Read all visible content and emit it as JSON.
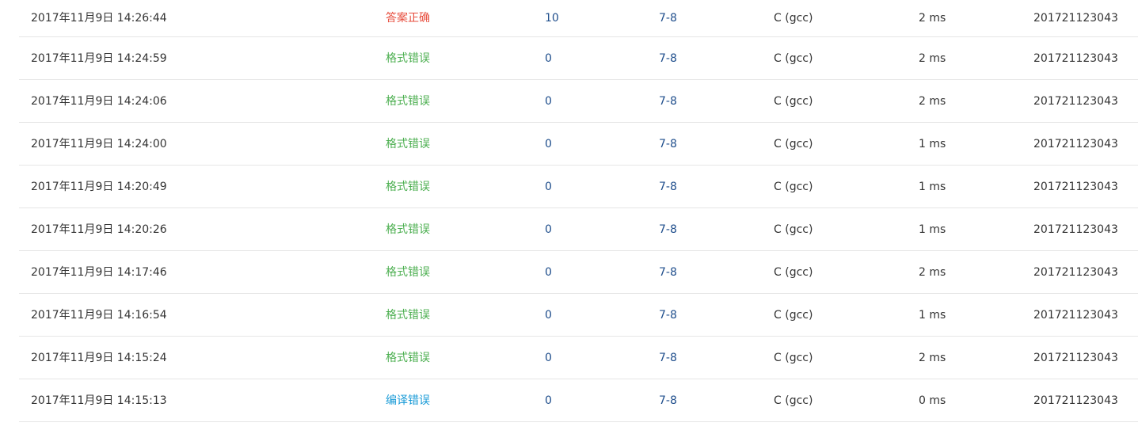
{
  "submissions": [
    {
      "time": "2017年11月9日 14:26:44",
      "status": "答案正确",
      "status_type": "ac",
      "score": "10",
      "problem": "7-8",
      "compiler": "C (gcc)",
      "runtime": "2 ms",
      "user": "201721123043"
    },
    {
      "time": "2017年11月9日 14:24:59",
      "status": "格式错误",
      "status_type": "pe",
      "score": "0",
      "problem": "7-8",
      "compiler": "C (gcc)",
      "runtime": "2 ms",
      "user": "201721123043"
    },
    {
      "time": "2017年11月9日 14:24:06",
      "status": "格式错误",
      "status_type": "pe",
      "score": "0",
      "problem": "7-8",
      "compiler": "C (gcc)",
      "runtime": "2 ms",
      "user": "201721123043"
    },
    {
      "time": "2017年11月9日 14:24:00",
      "status": "格式错误",
      "status_type": "pe",
      "score": "0",
      "problem": "7-8",
      "compiler": "C (gcc)",
      "runtime": "1 ms",
      "user": "201721123043"
    },
    {
      "time": "2017年11月9日 14:20:49",
      "status": "格式错误",
      "status_type": "pe",
      "score": "0",
      "problem": "7-8",
      "compiler": "C (gcc)",
      "runtime": "1 ms",
      "user": "201721123043"
    },
    {
      "time": "2017年11月9日 14:20:26",
      "status": "格式错误",
      "status_type": "pe",
      "score": "0",
      "problem": "7-8",
      "compiler": "C (gcc)",
      "runtime": "1 ms",
      "user": "201721123043"
    },
    {
      "time": "2017年11月9日 14:17:46",
      "status": "格式错误",
      "status_type": "pe",
      "score": "0",
      "problem": "7-8",
      "compiler": "C (gcc)",
      "runtime": "2 ms",
      "user": "201721123043"
    },
    {
      "time": "2017年11月9日 14:16:54",
      "status": "格式错误",
      "status_type": "pe",
      "score": "0",
      "problem": "7-8",
      "compiler": "C (gcc)",
      "runtime": "1 ms",
      "user": "201721123043"
    },
    {
      "time": "2017年11月9日 14:15:24",
      "status": "格式错误",
      "status_type": "pe",
      "score": "0",
      "problem": "7-8",
      "compiler": "C (gcc)",
      "runtime": "2 ms",
      "user": "201721123043"
    },
    {
      "time": "2017年11月9日 14:15:13",
      "status": "编译错误",
      "status_type": "ce",
      "score": "0",
      "problem": "7-8",
      "compiler": "C (gcc)",
      "runtime": "0 ms",
      "user": "201721123043"
    }
  ],
  "colors": {
    "accepted": "#e74c3c",
    "presentation_error": "#4caf50",
    "compile_error": "#1a9bd7",
    "link": "#1f4e8c"
  }
}
